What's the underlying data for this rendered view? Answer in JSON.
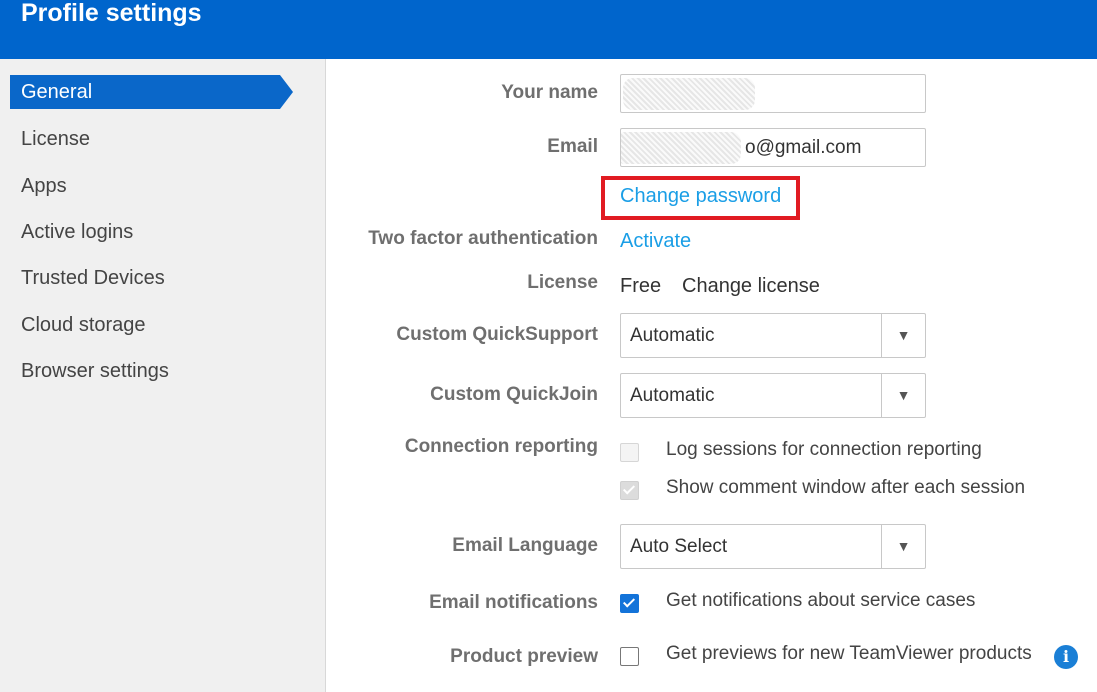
{
  "header": {
    "title": "Profile settings"
  },
  "sidebar": {
    "items": [
      {
        "label": "General",
        "active": true
      },
      {
        "label": "License"
      },
      {
        "label": "Apps"
      },
      {
        "label": "Active logins"
      },
      {
        "label": "Trusted Devices"
      },
      {
        "label": "Cloud storage"
      },
      {
        "label": "Browser settings"
      }
    ]
  },
  "form": {
    "your_name": {
      "label": "Your name",
      "value": ""
    },
    "email": {
      "label": "Email",
      "value_suffix": "o@gmail.com"
    },
    "change_password": "Change password",
    "two_factor": {
      "label": "Two factor authentication",
      "action": "Activate"
    },
    "license": {
      "label": "License",
      "value": "Free",
      "action": "Change license"
    },
    "custom_quicksupport": {
      "label": "Custom QuickSupport",
      "value": "Automatic"
    },
    "custom_quickjoin": {
      "label": "Custom QuickJoin",
      "value": "Automatic"
    },
    "connection_reporting": {
      "label": "Connection reporting",
      "log_sessions": "Log sessions for connection reporting",
      "show_comment": "Show comment window after each session"
    },
    "email_language": {
      "label": "Email Language",
      "value": "Auto Select"
    },
    "email_notifications": {
      "label": "Email notifications",
      "option": "Get notifications about service cases"
    },
    "product_preview": {
      "label": "Product preview",
      "option": "Get previews for new TeamViewer products"
    }
  },
  "icons": {
    "dropdown": "▼",
    "info": "i",
    "accent": "#0065cc",
    "highlight": "#e11b22"
  }
}
